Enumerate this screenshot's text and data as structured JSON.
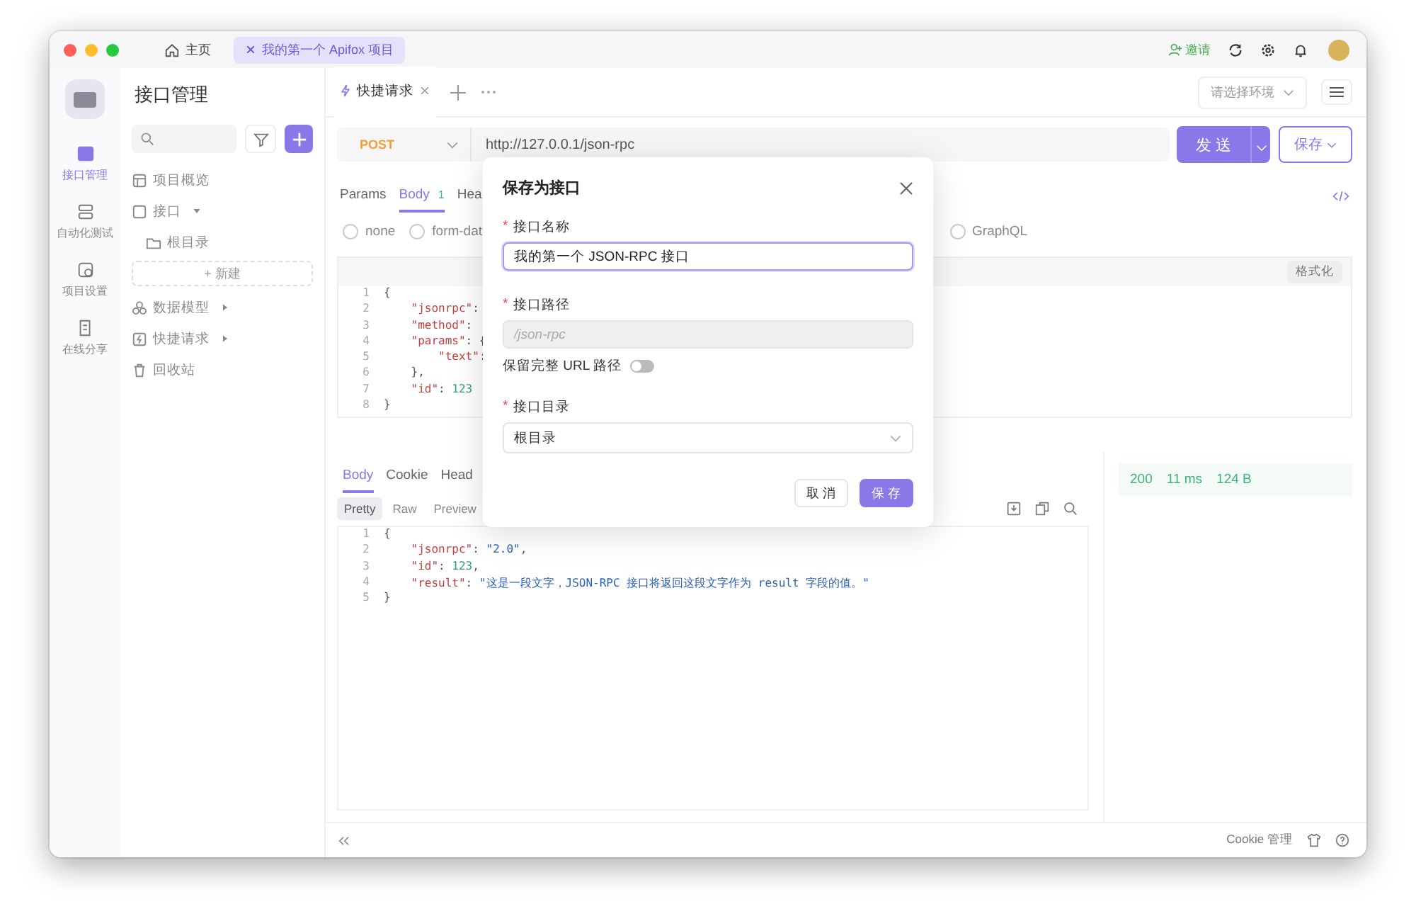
{
  "top_tabs": [
    {
      "label": "主页",
      "kind": "home",
      "selected": false
    },
    {
      "label": "我的第一个 Apifox 项目",
      "kind": "project",
      "selected": true
    }
  ],
  "header": {
    "invite": "邀请"
  },
  "nav_rail": [
    {
      "label": "接口管理",
      "kind": "api",
      "selected": true
    },
    {
      "label": "自动化测试",
      "kind": "test",
      "selected": false
    },
    {
      "label": "项目设置",
      "kind": "settings",
      "selected": false
    },
    {
      "label": "在线分享",
      "kind": "share",
      "selected": false
    }
  ],
  "sidebar": {
    "title": "接口管理",
    "new_button": "+ 新建",
    "items": [
      {
        "label": "项目概览",
        "kind": "overview"
      },
      {
        "label": "接口",
        "kind": "api",
        "expanded": true,
        "children": [
          {
            "label": "根目录",
            "kind": "folder"
          }
        ]
      },
      {
        "label": "数据模型",
        "kind": "model",
        "expanded": false
      },
      {
        "label": "快捷请求",
        "kind": "quick",
        "expanded": false
      },
      {
        "label": "回收站",
        "kind": "trash"
      }
    ]
  },
  "request_tabs": [
    {
      "label": "快捷请求",
      "selected": true
    }
  ],
  "environment": {
    "placeholder": "请选择环境"
  },
  "request": {
    "method": "POST",
    "url": "http://127.0.0.1/json-rpc",
    "send": "发 送",
    "save": "保存"
  },
  "param_tabs": [
    {
      "label": "Params",
      "selected": false
    },
    {
      "label": "Body",
      "badge": "1",
      "selected": true
    },
    {
      "label": "Hea",
      "selected": false
    }
  ],
  "body_types": [
    {
      "label": "none",
      "selected": false
    },
    {
      "label": "form-dat",
      "selected": false
    },
    {
      "label": "GraphQL",
      "selected": false
    }
  ],
  "format_button": "格式化",
  "request_code": [
    {
      "n": "1",
      "tokens": [
        {
          "t": "{",
          "kind": "punct"
        }
      ]
    },
    {
      "n": "2",
      "tokens": [
        {
          "t": "    \"jsonrpc\"",
          "kind": "key"
        },
        {
          "t": ":",
          "kind": "punct"
        }
      ]
    },
    {
      "n": "3",
      "tokens": [
        {
          "t": "    \"method\"",
          "kind": "key"
        },
        {
          "t": ":",
          "kind": "punct"
        }
      ]
    },
    {
      "n": "4",
      "tokens": [
        {
          "t": "    \"params\"",
          "kind": "key"
        },
        {
          "t": ": {",
          "kind": "punct"
        }
      ]
    },
    {
      "n": "5",
      "tokens": [
        {
          "t": "        \"text\"",
          "kind": "key"
        },
        {
          "t": ":",
          "kind": "punct"
        }
      ]
    },
    {
      "n": "6",
      "tokens": [
        {
          "t": "    },",
          "kind": "punct"
        }
      ]
    },
    {
      "n": "7",
      "tokens": [
        {
          "t": "    \"id\"",
          "kind": "key"
        },
        {
          "t": ": ",
          "kind": "punct"
        },
        {
          "t": "123",
          "kind": "number"
        }
      ]
    },
    {
      "n": "8",
      "tokens": [
        {
          "t": "}",
          "kind": "punct"
        }
      ]
    }
  ],
  "response_tabs": [
    {
      "label": "Body",
      "selected": true
    },
    {
      "label": "Cookie",
      "selected": false
    },
    {
      "label": "Head",
      "selected": false
    }
  ],
  "view_tabs": [
    {
      "label": "Pretty",
      "selected": true
    },
    {
      "label": "Raw",
      "selected": false
    },
    {
      "label": "Preview",
      "selected": false
    }
  ],
  "response_code": [
    {
      "n": "1",
      "tokens": [
        {
          "t": "{",
          "kind": "punct"
        }
      ]
    },
    {
      "n": "2",
      "tokens": [
        {
          "t": "    \"jsonrpc\"",
          "kind": "key"
        },
        {
          "t": ": ",
          "kind": "punct"
        },
        {
          "t": "\"2.0\"",
          "kind": "string"
        },
        {
          "t": ",",
          "kind": "punct"
        }
      ]
    },
    {
      "n": "3",
      "tokens": [
        {
          "t": "    \"id\"",
          "kind": "key"
        },
        {
          "t": ": ",
          "kind": "punct"
        },
        {
          "t": "123",
          "kind": "number"
        },
        {
          "t": ",",
          "kind": "punct"
        }
      ]
    },
    {
      "n": "4",
      "tokens": [
        {
          "t": "    \"result\"",
          "kind": "key"
        },
        {
          "t": ": ",
          "kind": "punct"
        },
        {
          "t": "\"这是一段文字，JSON-RPC 接口将返回这段文字作为 result 字段的值。\"",
          "kind": "string"
        }
      ]
    },
    {
      "n": "5",
      "tokens": [
        {
          "t": "}",
          "kind": "punct"
        }
      ]
    }
  ],
  "response_meta": {
    "status": "200",
    "time": "11 ms",
    "size": "124 B"
  },
  "footer": {
    "cookie": "Cookie 管理"
  },
  "dialog": {
    "title": "保存为接口",
    "fields": [
      {
        "kind": "text",
        "label": "接口名称",
        "required_mark": "*",
        "value": "我的第一个 JSON-RPC 接口",
        "focused": true,
        "disabled": false
      },
      {
        "kind": "text",
        "label": "接口路径",
        "required_mark": "*",
        "placeholder": "/json-rpc",
        "focused": false,
        "disabled": true
      },
      {
        "kind": "toggle",
        "label": "保留完整 URL 路径",
        "on": false
      },
      {
        "kind": "select",
        "label": "接口目录",
        "required_mark": "*",
        "value": "根目录"
      }
    ],
    "buttons": [
      {
        "label": "取 消",
        "kind": "secondary"
      },
      {
        "label": "保 存",
        "kind": "primary"
      }
    ]
  }
}
